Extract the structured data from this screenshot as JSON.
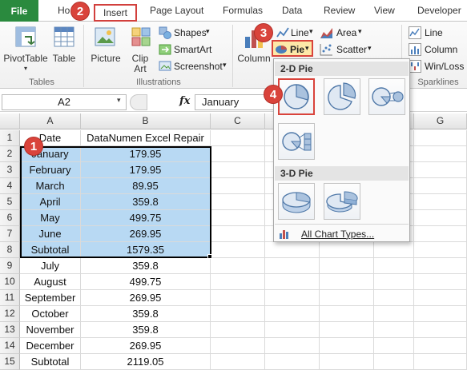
{
  "tabs": {
    "file": "File",
    "home": "Ho",
    "insert": "Insert",
    "page_layout": "Page Layout",
    "formulas": "Formulas",
    "data": "Data",
    "review": "Review",
    "view": "View",
    "developer": "Developer"
  },
  "ribbon": {
    "pivottable": "PivotTable",
    "table": "Table",
    "group_tables": "Tables",
    "picture": "Picture",
    "clip": "Clip",
    "art": "Art",
    "shapes": "Shapes",
    "smartart": "SmartArt",
    "screenshot": "Screenshot",
    "group_illustrations": "Illustrations",
    "column": "Column",
    "line": "Line",
    "pie": "Pie",
    "area": "Area",
    "scatter": "Scatter",
    "spark_line": "Line",
    "spark_column": "Column",
    "spark_winloss": "Win/Loss",
    "group_sparklines": "Sparklines"
  },
  "markers": [
    "1",
    "2",
    "3",
    "4"
  ],
  "formula_bar": {
    "name_box": "A2",
    "fx": "fx",
    "value": "January"
  },
  "pie_menu": {
    "header_2d": "2-D Pie",
    "header_3d": "3-D Pie",
    "all_types": "All Chart Types..."
  },
  "columns": [
    "A",
    "B",
    "C",
    "D",
    "E",
    "F",
    "G"
  ],
  "rows": [
    {
      "n": "1",
      "a": "Date",
      "b": "DataNumen Excel Repair"
    },
    {
      "n": "2",
      "a": "January",
      "b": "179.95"
    },
    {
      "n": "3",
      "a": "February",
      "b": "179.95"
    },
    {
      "n": "4",
      "a": "March",
      "b": "89.95"
    },
    {
      "n": "5",
      "a": "April",
      "b": "359.8"
    },
    {
      "n": "6",
      "a": "May",
      "b": "499.75"
    },
    {
      "n": "7",
      "a": "June",
      "b": "269.95"
    },
    {
      "n": "8",
      "a": "Subtotal",
      "b": "1579.35"
    },
    {
      "n": "9",
      "a": "July",
      "b": "359.8"
    },
    {
      "n": "10",
      "a": "August",
      "b": "499.75"
    },
    {
      "n": "11",
      "a": "September",
      "b": "269.95"
    },
    {
      "n": "12",
      "a": "October",
      "b": "359.8"
    },
    {
      "n": "13",
      "a": "November",
      "b": "359.8"
    },
    {
      "n": "14",
      "a": "December",
      "b": "269.95"
    },
    {
      "n": "15",
      "a": "Subtotal",
      "b": "2119.05"
    }
  ],
  "colors": {
    "accent_red": "#d9433b",
    "file_green": "#2a8a3e",
    "selection": "#b8d9f3"
  }
}
